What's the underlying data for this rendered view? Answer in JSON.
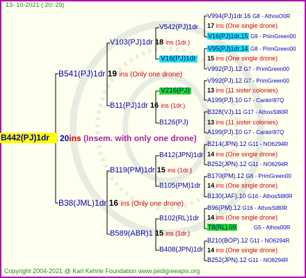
{
  "date": "13- 10-2021 ( 20: 29)",
  "footer": "Copyright 2004-2021 @ Karl Kehrle Foundation    www.pedigreeapis.org",
  "root": {
    "name": "B442(PJ)1dr",
    "ins": "20",
    "ins_label": "ins",
    "note": "(Insem. with only one drone)"
  },
  "gen1": [
    {
      "name": "B541(PJ)1dr",
      "ins": "19",
      "note": "ins   (Only one drone)"
    },
    {
      "name": "B38(JML)1dr",
      "ins": "16",
      "note": "ins   (Only one drone)"
    }
  ],
  "gen2": [
    {
      "name": "V103(PJ)1dr",
      "ins": "18",
      "note": "ins  (1dr.)"
    },
    {
      "name": "B11(PJ)1dr",
      "ins": "16",
      "note": "ins  (1dr.)"
    },
    {
      "name": "B119(PM)1dr",
      "ins": "15",
      "note": "ins  (1dr.)"
    },
    {
      "name": "B589(ABR)1",
      "ins": "15",
      "note": "ins  (1dr.)"
    }
  ],
  "gen3": [
    {
      "name": "V542(PJ)1dr"
    },
    {
      "name": "V16(PJ)1dr"
    },
    {
      "name": "V216(PJ)"
    },
    {
      "name": "B126(PJ)"
    },
    {
      "name": "B412(JPN)1dr"
    },
    {
      "name": "B105(PM)1dr"
    },
    {
      "name": "B102(RL)1dr"
    },
    {
      "name": "B408(JPN)1dr"
    }
  ],
  "gen4": [
    {
      "name": "V994(PJ)1dr.16",
      "breed": "G8 - AthosO0R"
    },
    {
      "ins": "17",
      "note": "ins (One single drone)"
    },
    {
      "name": "V16(PJ)1dr.15",
      "breed": "G9 - PrimGreen00"
    },
    {
      "name": "V95(PJ)1dr.14",
      "breed": "G8 - PrimGreen00"
    },
    {
      "ins": "15",
      "note": "ins (One single drone)"
    },
    {
      "name": "V992(PJ).12",
      "breed": "G7 - PrimGreen00"
    },
    {
      "name": "V992(PJ).12",
      "breed": "G7 - PrimGreen00"
    },
    {
      "ins": "13",
      "note": "ins (11 sister colonies)"
    },
    {
      "name": "A199(PJ).10",
      "breed": "G7 - Cankiri97Q"
    },
    {
      "name": "B328(VJ).11",
      "breed": "G17 - AthosSt80R"
    },
    {
      "ins": "13",
      "note": "ins (11 sister colonies)"
    },
    {
      "name": "A199(PJ).10",
      "breed": "G7 - Cankiri97Q"
    },
    {
      "name": "B214(JPN).12",
      "breed": "G11 - NO6294R"
    },
    {
      "ins": "14",
      "note": "ins (One single drone)"
    },
    {
      "name": "B252(JPN).12",
      "breed": "G11 - NO6294R"
    },
    {
      "name": "B170(PM).12",
      "breed": "G6 - PrimGreen00"
    },
    {
      "ins": "14",
      "note": "ins (One single drone)"
    },
    {
      "name": "B130(JAF).10",
      "breed": "G16 - AthosSt80R"
    },
    {
      "name": "B96(PM).12",
      "breed": "G16 - AthosSt80R"
    },
    {
      "ins": "14",
      "note": "ins (One single drone)"
    },
    {
      "name": "T8(RL).09",
      "breed": "G5 - Athos00R"
    },
    {
      "name": "B210(BOP).12",
      "breed": "G11 - NO6294R"
    },
    {
      "ins": "14",
      "note": "ins (One single drone)"
    },
    {
      "name": "B252(JPN).12",
      "breed": "G11 - NO6294R"
    }
  ]
}
